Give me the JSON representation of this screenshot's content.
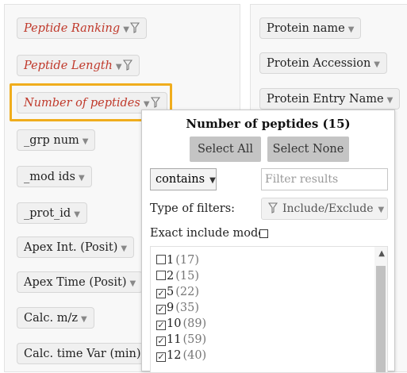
{
  "left_panel": {
    "items": [
      {
        "label": "Peptide Ranking",
        "filtered": true
      },
      {
        "label": "Peptide Length",
        "filtered": true
      },
      {
        "label": "Number of peptides",
        "filtered": true
      },
      {
        "label": "_grp num",
        "filtered": false
      },
      {
        "label": "_mod ids",
        "filtered": false
      },
      {
        "label": "_prot_id",
        "filtered": false
      },
      {
        "label": "Apex Int. (Posit)",
        "filtered": false
      },
      {
        "label": "Apex Time (Posit)",
        "filtered": false
      },
      {
        "label": "Calc. m/z",
        "filtered": false
      },
      {
        "label": "Calc. time Var (min)",
        "filtered": false
      }
    ]
  },
  "right_panel": {
    "items": [
      {
        "label": "Protein name"
      },
      {
        "label": "Protein Accession"
      },
      {
        "label": "Protein Entry Name"
      }
    ]
  },
  "popup": {
    "title": "Number of peptides (15)",
    "select_all": "Select All",
    "select_none": "Select None",
    "match_mode": "contains",
    "filter_placeholder": "Filter results",
    "type_of_filters_label": "Type of filters:",
    "include_exclude": "Include/Exclude",
    "exact_mode_label": "Exact include mode:",
    "exact_mode_checked": false,
    "values": [
      {
        "value": "1",
        "count": "(17)",
        "checked": false
      },
      {
        "value": "2",
        "count": "(15)",
        "checked": false
      },
      {
        "value": "5",
        "count": "(22)",
        "checked": true
      },
      {
        "value": "9",
        "count": "(35)",
        "checked": true
      },
      {
        "value": "10",
        "count": "(89)",
        "checked": true
      },
      {
        "value": "11",
        "count": "(59)",
        "checked": true
      },
      {
        "value": "12",
        "count": "(40)",
        "checked": true
      }
    ]
  },
  "colors": {
    "filtered_text": "#c0392b",
    "highlight_border": "#f0ad1d",
    "button_bg": "#c4c4c4"
  }
}
